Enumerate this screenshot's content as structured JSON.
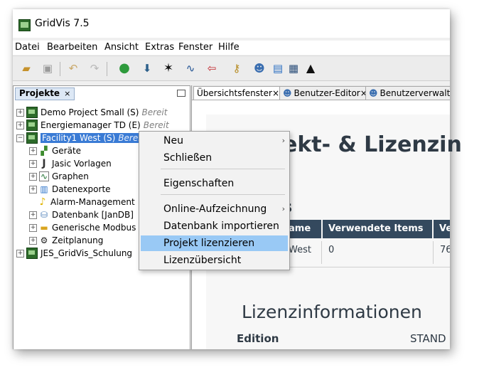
{
  "window": {
    "title": "GridVis 7.5"
  },
  "menubar": {
    "items": [
      "Datei",
      "Bearbeiten",
      "Ansicht",
      "Extras",
      "Fenster",
      "Hilfe"
    ]
  },
  "toolbar": {
    "icons": [
      "open-project-icon",
      "save-icon",
      "undo-icon",
      "redo-icon",
      "sync-icon",
      "download-icon",
      "topology-icon",
      "graph-icon",
      "import-icon",
      "key-icon",
      "users-icon",
      "dialog-icon",
      "device-icon",
      "graduation-cap-icon"
    ]
  },
  "left_panel": {
    "tab_label": "Projekte",
    "tab_close": "×",
    "tree": [
      {
        "label": "Demo Project Small (S)",
        "status": "Bereit"
      },
      {
        "label": "Energiemanager TD (E)",
        "status": "Bereit"
      },
      {
        "label": "Facility1 West (S)",
        "status": "Bereit"
      },
      {
        "label": "Geräte"
      },
      {
        "label": "Jasic Vorlagen"
      },
      {
        "label": "Graphen"
      },
      {
        "label": "Datenexporte"
      },
      {
        "label": "Alarm-Management"
      },
      {
        "label": "Datenbank [JanDB]"
      },
      {
        "label": "Generische Modbus"
      },
      {
        "label": "Zeitplanung"
      },
      {
        "label": "JES_GridVis_Schulung"
      }
    ]
  },
  "editor_tabs": [
    {
      "label": "Übersichtsfenster",
      "close": "×"
    },
    {
      "label": "Benutzer-Editor",
      "close": "×"
    },
    {
      "label": "Benutzerverwaltu"
    }
  ],
  "content": {
    "heading_fragment": "ekt- & Lizenzin",
    "heading_side_fragment": "s",
    "table_headers": [
      "ame",
      "Verwendete Items",
      "Ve"
    ],
    "table_row": [
      "West",
      "0",
      "76"
    ],
    "license_heading": "Lizenzinformationen",
    "edition_label": "Edition",
    "edition_value": "STAND"
  },
  "context_menu": {
    "items": [
      {
        "label": "Neu",
        "has_submenu": true,
        "arrow": "›"
      },
      {
        "label": "Schließen"
      },
      {
        "label": "Eigenschaften"
      },
      {
        "label": "Online-Aufzeichnung",
        "has_submenu": true,
        "arrow": "›"
      },
      {
        "label": "Datenbank importieren"
      },
      {
        "label": "Projekt lizenzieren",
        "highlighted": true
      },
      {
        "label": "Lizenzübersicht"
      }
    ]
  },
  "colors": {
    "selection": "#3a7bd5",
    "menu_highlight": "#99c9f5",
    "table_header": "#34495e"
  }
}
